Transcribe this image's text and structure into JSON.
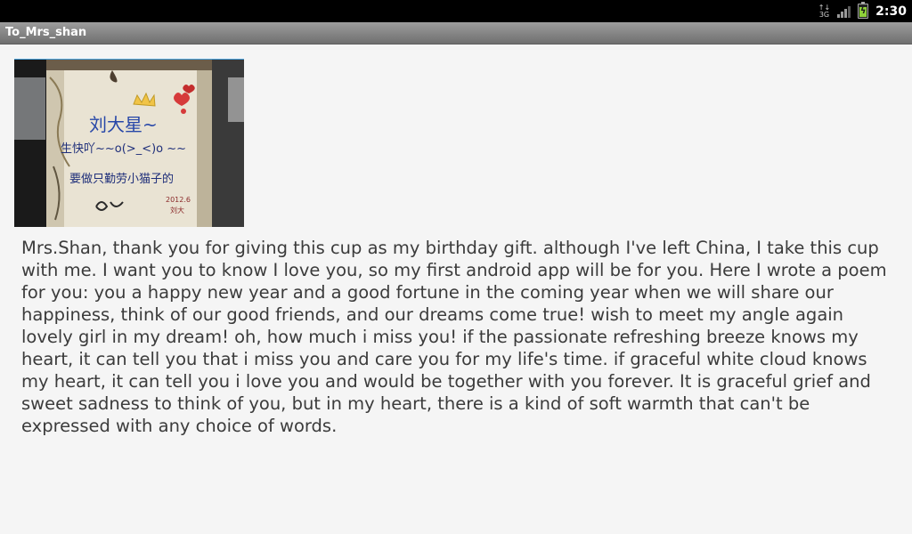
{
  "status_bar": {
    "network_type": "3G",
    "time": "2:30"
  },
  "app": {
    "title": "To_Mrs_shan"
  },
  "photo": {
    "cup_text_line1": "刘大星~",
    "cup_text_line2": "生快吖~~o(>_<)o ~~",
    "cup_text_line3": "要做只勤劳小猫子的"
  },
  "message": {
    "text": "Mrs.Shan, thank you for giving this cup as my birthday gift. although I've left China, I take this cup with me. I want you to know I love you, so my first android app will be for you. Here I wrote a poem for you: you a happy new year and a good fortune in the coming year when we will share our happiness, think of our good friends, and our dreams come true! wish to meet my angle again lovely girl in my dream! oh, how much i miss you! if the passionate refreshing breeze knows my heart, it can tell you that i miss you and care you for my life's time. if graceful white cloud knows my heart, it can tell you i love you and would be together with you forever. It is graceful grief and sweet sadness to think of you, but in my heart, there is a kind of soft warmth that can't be expressed with any choice of words."
  }
}
